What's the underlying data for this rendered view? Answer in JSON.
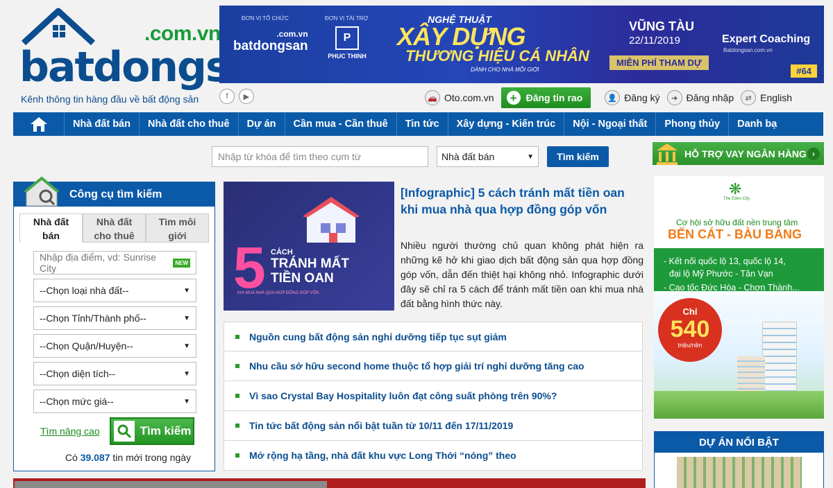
{
  "logo": {
    "domain": ".com.vn",
    "word": "batdongsan",
    "tagline": "Kênh thông tin hàng đầu về bất động sản"
  },
  "socials": {
    "facebook": "f",
    "youtube": "▶"
  },
  "banner": {
    "organizer_label": "ĐƠN VỊ TỔ CHỨC",
    "sponsor_label": "ĐƠN VỊ TÀI TRỢ",
    "logo_word": "batdongsan",
    "logo_domain": ".com.vn",
    "sponsor_name": "PHUC THINH",
    "line1": "NGHỆ THUẬT",
    "line2": "XÂY DỰNG",
    "line3": "THƯƠNG HIỆU CÁ NHÂN",
    "line4": "DÀNH CHO NHÀ MÔI GIỚI",
    "city": "VŨNG TÀU",
    "date": "22/11/2019",
    "free": "MIỄN PHÍ THAM DỰ",
    "coach": "Expert Coaching",
    "coach_site": "Batdongsan.com.vn",
    "issue": "#64"
  },
  "toplinks": {
    "oto": "Oto.com.vn",
    "post": "Đăng tin rao",
    "register": "Đăng ký",
    "login": "Đăng nhập",
    "language": "English"
  },
  "nav": {
    "items": [
      "Nhà đất bán",
      "Nhà đất cho thuê",
      "Dự án",
      "Cần mua - Cần thuê",
      "Tin tức",
      "Xây dựng - Kiến trúc",
      "Nội - Ngoại thất",
      "Phong thủy",
      "Danh bạ"
    ]
  },
  "search": {
    "placeholder": "Nhập từ khóa để tìm theo cụm từ",
    "category": "Nhà đất bán",
    "button": "Tìm kiếm"
  },
  "panel": {
    "title": "Công cụ tìm kiếm",
    "tabs": [
      {
        "l1": "Nhà đất",
        "l2": "bán"
      },
      {
        "l1": "Nhà đất",
        "l2": "cho thuê"
      },
      {
        "l1": "Tìm môi",
        "l2": "giới"
      }
    ],
    "location_placeholder": "Nhập địa điểm, vd: Sunrise City",
    "new_badge": "NEW",
    "selects": [
      "--Chọn loại nhà đất--",
      "--Chọn Tỉnh/Thành phố--",
      "--Chọn Quận/Huyện--",
      "--Chọn diện tích--",
      "--Chọn mức giá--"
    ],
    "advanced": "Tìm nâng cao",
    "search_button": "Tìm kiếm",
    "count_prefix": "Có",
    "count_value": "39.087",
    "count_suffix": "tin mới trong ngày"
  },
  "featured_article": {
    "title": "[Infographic] 5 cách tránh mất tiền oan khi mua nhà qua hợp đồng góp vốn",
    "description": "Nhiều người thường chủ quan không phát hiện ra những kẽ hở khi giao dịch bất động sản qua hợp đồng góp vốn, dẫn đến thiệt hại không nhỏ. Infographic dưới đây sẽ chỉ ra 5 cách để tránh mất tiền oan khi mua nhà đất bằng hình thức này.",
    "image": {
      "number": "5",
      "t1": "CÁCH",
      "t2a": "TRÁNH MẤT",
      "t2b": "TIỀN OAN",
      "t3": "KHI MUA NHÀ QUA HỢP ĐỒNG GÓP VỐN"
    }
  },
  "news": [
    "Nguồn cung bất động sản nghỉ dưỡng tiếp tục sụt giảm",
    "Nhu cầu sở hữu second home thuộc tổ hợp giải trí nghỉ dưỡng tăng cao",
    "Vì sao Crystal Bay Hospitality luôn đạt công suất phòng trên 90%?",
    "Tin tức bất động sản nổi bật tuần từ 10/11 đến 17/11/2019",
    "Mở rộng hạ tầng, nhà đất khu vực Long Thới “nóng” theo"
  ],
  "sidebar": {
    "loan": "HỖ TRỢ VAY NGÂN HÀNG",
    "ad": {
      "brand": "The Eden City",
      "opp": "Cơ hội sở hữu đất nền trung tâm",
      "region": "BẾN CÁT - BÀU BÀNG",
      "points": [
        "- Kết nối quốc lộ 13, quốc lộ 14,",
        "đại lộ Mỹ Phước - Tân Vạn",
        "- Cao tốc Đức Hòa - Chơn Thành..."
      ],
      "price_label": "Chỉ",
      "price": "540",
      "price_unit": "triệu/nền"
    },
    "featured_title": "DỰ ÁN NỔI BẬT"
  },
  "colors": {
    "primary": "#0b5aa8",
    "green": "#2a9a2a",
    "accent": "#f07b17"
  }
}
